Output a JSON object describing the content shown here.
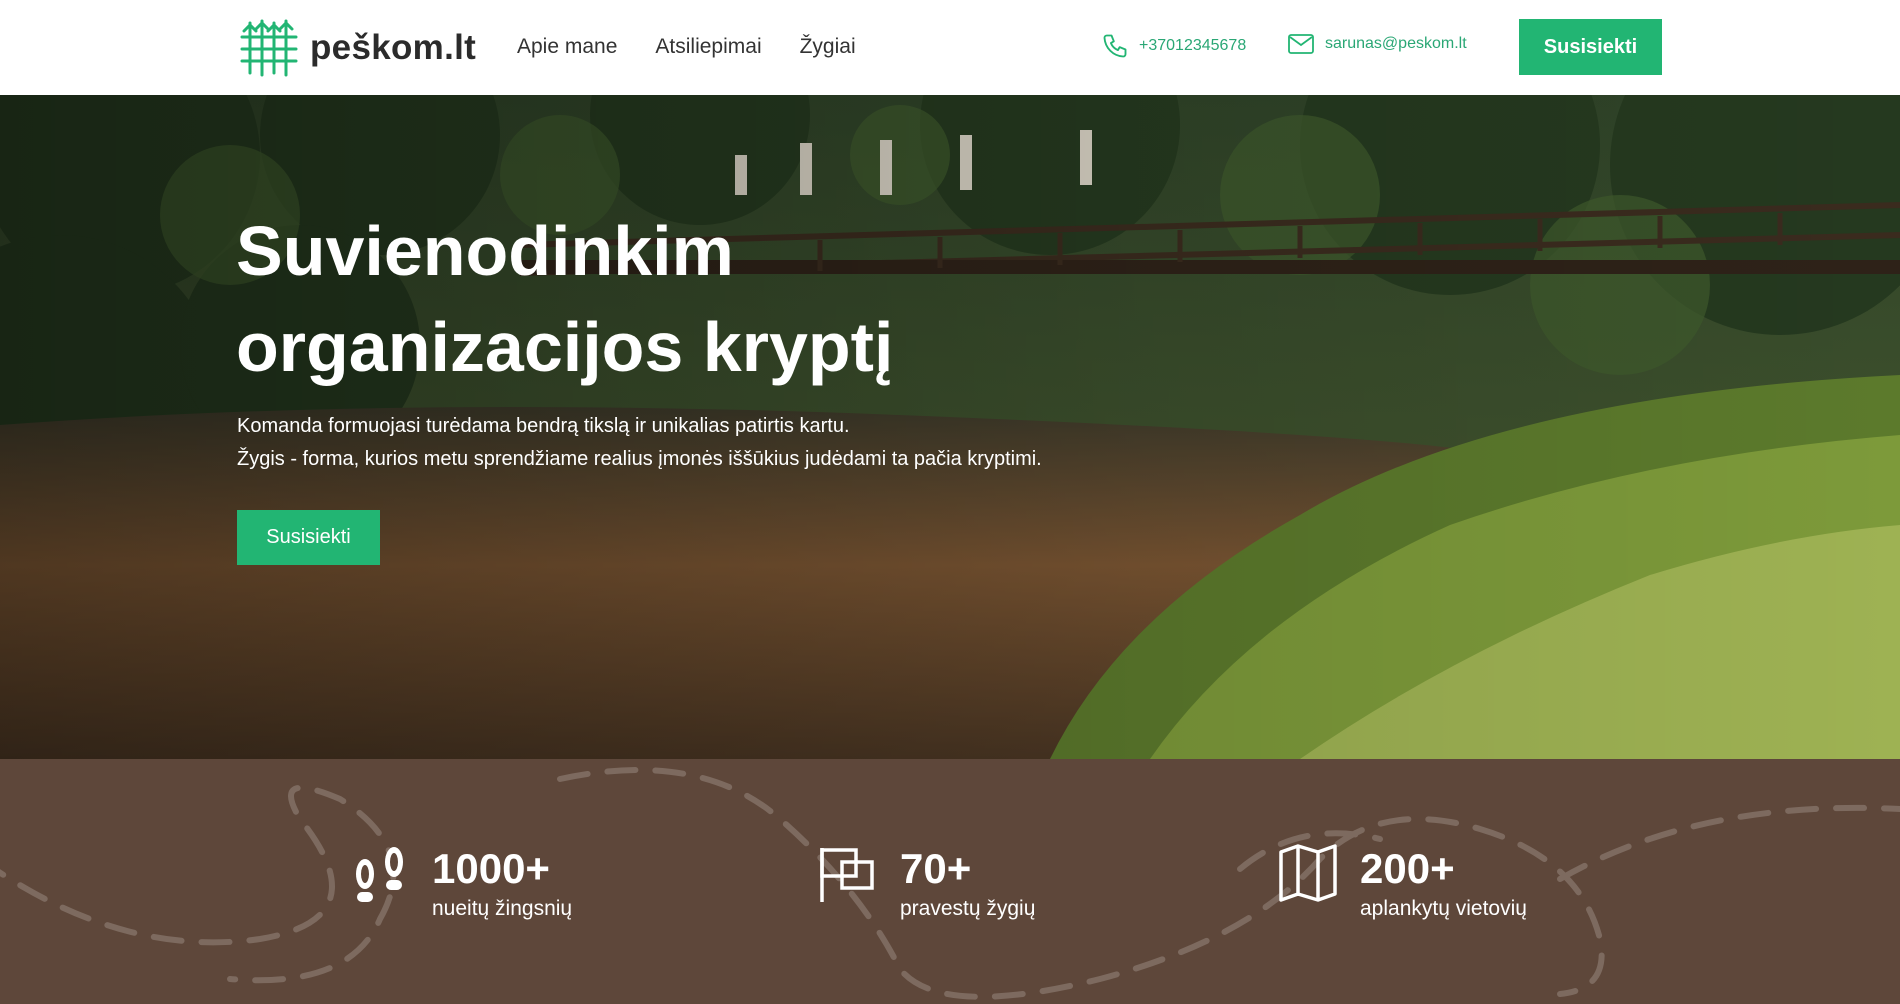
{
  "header": {
    "logo_text": "peškom.lt",
    "nav": [
      "Apie mane",
      "Atsiliepimai",
      "Žygiai"
    ],
    "phone": "+37012345678",
    "email": "sarunas@peskom.lt",
    "cta_label": "Susisiekti",
    "brand_color": "#22b573"
  },
  "hero": {
    "title_lines": [
      "Suvienodinkim",
      "organizacijos kryptį"
    ],
    "text_lines": [
      "Komanda formuojasi turėdama bendrą tikslą ir unikalias patirtis kartu.",
      "Žygis - forma, kurios metu sprendžiame realius įmonės iššūkius judėdami ta pačia kryptimi."
    ],
    "cta_label": "Susisiekti"
  },
  "stats": [
    {
      "icon": "footprints-icon",
      "value": "1000+",
      "label": "nueitų žingsnių"
    },
    {
      "icon": "flag-icon",
      "value": "70+",
      "label": "pravestų žygių"
    },
    {
      "icon": "map-icon",
      "value": "200+",
      "label": "aplankytų vietovių"
    }
  ],
  "colors": {
    "stats_background": "#5e473a",
    "accent": "#22b573"
  }
}
